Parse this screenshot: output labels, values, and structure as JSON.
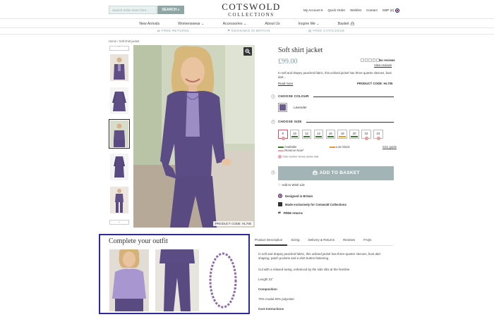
{
  "header": {
    "search_placeholder": "Search entire store here...",
    "search_button": "SEARCH",
    "logo_line1": "COTSWOLD",
    "logo_line2": "COLLECTIONS",
    "links": [
      "My Account",
      "Quick Order",
      "Wishlist",
      "Contact"
    ],
    "currency": "GBP (£)"
  },
  "nav": {
    "items": [
      "New Arrivals",
      "Womenswear",
      "Accessories",
      "About Us",
      "Inspire Me",
      "Basket"
    ]
  },
  "usp": {
    "returns": "FREE RETURNS",
    "designed": "DESIGNED IN BRITAIN",
    "catalogue": "FREE CATALOGUE"
  },
  "breadcrumb": {
    "home": "Home",
    "sep": "/",
    "current": "Soft shirt jacket"
  },
  "product": {
    "title": "Soft shirt jacket",
    "price": "£99.00",
    "no_reviews": "No reviews",
    "view_reviews": "View reviews",
    "description": "In soft and drapey peached fabric, this unlined jacket has three-quarter sleeves, bust dart...",
    "read_more": "Read more",
    "product_code": "PRODUCT CODE: HL705",
    "image_code": "PRODUCT CODE: HL705"
  },
  "steps": {
    "colour_num": "1",
    "colour_label": "CHOOSE COLOUR",
    "colour_value": "Lavender",
    "colour_hex": "#6a5b8e",
    "size_num": "2",
    "size_label": "CHOOSE SIZE",
    "sizes": [
      "8",
      "10",
      "12",
      "14",
      "16",
      "18",
      "20",
      "22",
      "24"
    ],
    "legend_available": "Available",
    "legend_low": "Low Stock",
    "legend_reserve": "Reserve Now*",
    "size_guide": "Size guide",
    "size_note": "*Size number shows weeks wait",
    "basket_num": "3",
    "basket_label": "ADD TO BASKET"
  },
  "wishlist": "Add to Wish List",
  "features": [
    "Designed in Britain",
    "Made exclusively for Cotswold Collections",
    "FREE returns"
  ],
  "outfit": {
    "title": "Complete your outfit"
  },
  "tabs": [
    "Product Description",
    "Sizing",
    "Delivery & Returns",
    "Reviews",
    "FAQs"
  ],
  "details": {
    "p1": "In soft and drapey peached fabric, this unlined jacket has three-quarter sleeves, bust dart shaping, patch pockets and a shirt button fastening.",
    "p2": "Cut with a relaxed swing, enhanced by the side slits at the hemline.",
    "p3": "Length 31\"",
    "composition_label": "Composition",
    "composition": "70% modal 30% polyester",
    "care_label": "Care Instructions"
  },
  "colors": {
    "accent": "#8fa5a6",
    "price": "#7f9aa0",
    "outfit_border": "#2d2aa0",
    "available": "#3e7a35",
    "low": "#e69c27",
    "reserve": "#e7a3ae"
  }
}
